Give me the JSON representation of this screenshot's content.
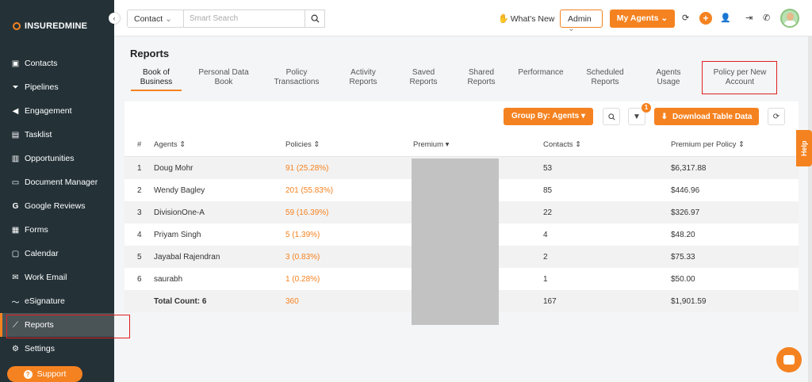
{
  "brand": "INSUREDMINE",
  "sidebar": {
    "items": [
      {
        "label": "Contacts",
        "icon": "id-card-icon"
      },
      {
        "label": "Pipelines",
        "icon": "funnel-icon"
      },
      {
        "label": "Engagement",
        "icon": "megaphone-icon"
      },
      {
        "label": "Tasklist",
        "icon": "clipboard-icon"
      },
      {
        "label": "Opportunities",
        "icon": "bar-chart-icon"
      },
      {
        "label": "Document Manager",
        "icon": "folder-icon"
      },
      {
        "label": "Google Reviews",
        "icon": "google-icon"
      },
      {
        "label": "Forms",
        "icon": "form-icon"
      },
      {
        "label": "Calendar",
        "icon": "calendar-icon"
      },
      {
        "label": "Work Email",
        "icon": "mail-icon"
      },
      {
        "label": "eSignature",
        "icon": "signature-icon"
      },
      {
        "label": "Reports",
        "icon": "line-chart-icon",
        "active": true
      },
      {
        "label": "Settings",
        "icon": "gear-icon"
      }
    ],
    "support_label": "Support"
  },
  "topbar": {
    "contact_select": "Contact",
    "search_placeholder": "Smart Search",
    "whats_new": "What's New",
    "admin_select": "Admin",
    "my_agents": "My Agents"
  },
  "page_title": "Reports",
  "tabs": [
    {
      "label": "Book of Business",
      "active": true
    },
    {
      "label": "Personal Data Book"
    },
    {
      "label": "Policy Transactions"
    },
    {
      "label": "Activity Reports"
    },
    {
      "label": "Saved Reports"
    },
    {
      "label": "Shared Reports"
    },
    {
      "label": "Performance"
    },
    {
      "label": "Scheduled Reports"
    },
    {
      "label": "Agents Usage"
    },
    {
      "label": "Policy per New Account"
    }
  ],
  "toolbar": {
    "group_by": "Group By: Agents",
    "filter_badge": "1",
    "download": "Download Table Data"
  },
  "table": {
    "headers": {
      "num": "#",
      "agents": "Agents",
      "policies": "Policies",
      "premium": "Premium",
      "contacts": "Contacts",
      "ppp": "Premium per Policy"
    },
    "rows": [
      {
        "num": "1",
        "agent": "Doug Mohr",
        "policies": "91 (25.28%)",
        "contacts": "53",
        "ppp": "$6,317.88"
      },
      {
        "num": "2",
        "agent": "Wendy Bagley",
        "policies": "201 (55.83%)",
        "contacts": "85",
        "ppp": "$446.96"
      },
      {
        "num": "3",
        "agent": "DivisionOne-A",
        "policies": "59 (16.39%)",
        "contacts": "22",
        "ppp": "$326.97"
      },
      {
        "num": "4",
        "agent": "Priyam Singh",
        "policies": "5 (1.39%)",
        "contacts": "4",
        "ppp": "$48.20"
      },
      {
        "num": "5",
        "agent": "Jayabal Rajendran",
        "policies": "3 (0.83%)",
        "contacts": "2",
        "ppp": "$75.33"
      },
      {
        "num": "6",
        "agent": "saurabh",
        "policies": "1 (0.28%)",
        "contacts": "1",
        "ppp": "$50.00"
      }
    ],
    "total": {
      "label": "Total Count: 6",
      "policies": "360",
      "contacts": "167",
      "ppp": "$1,901.59"
    }
  },
  "help_label": "Help",
  "colors": {
    "accent": "#f58220",
    "sidebar": "#243238",
    "highlight": "#e02020"
  }
}
